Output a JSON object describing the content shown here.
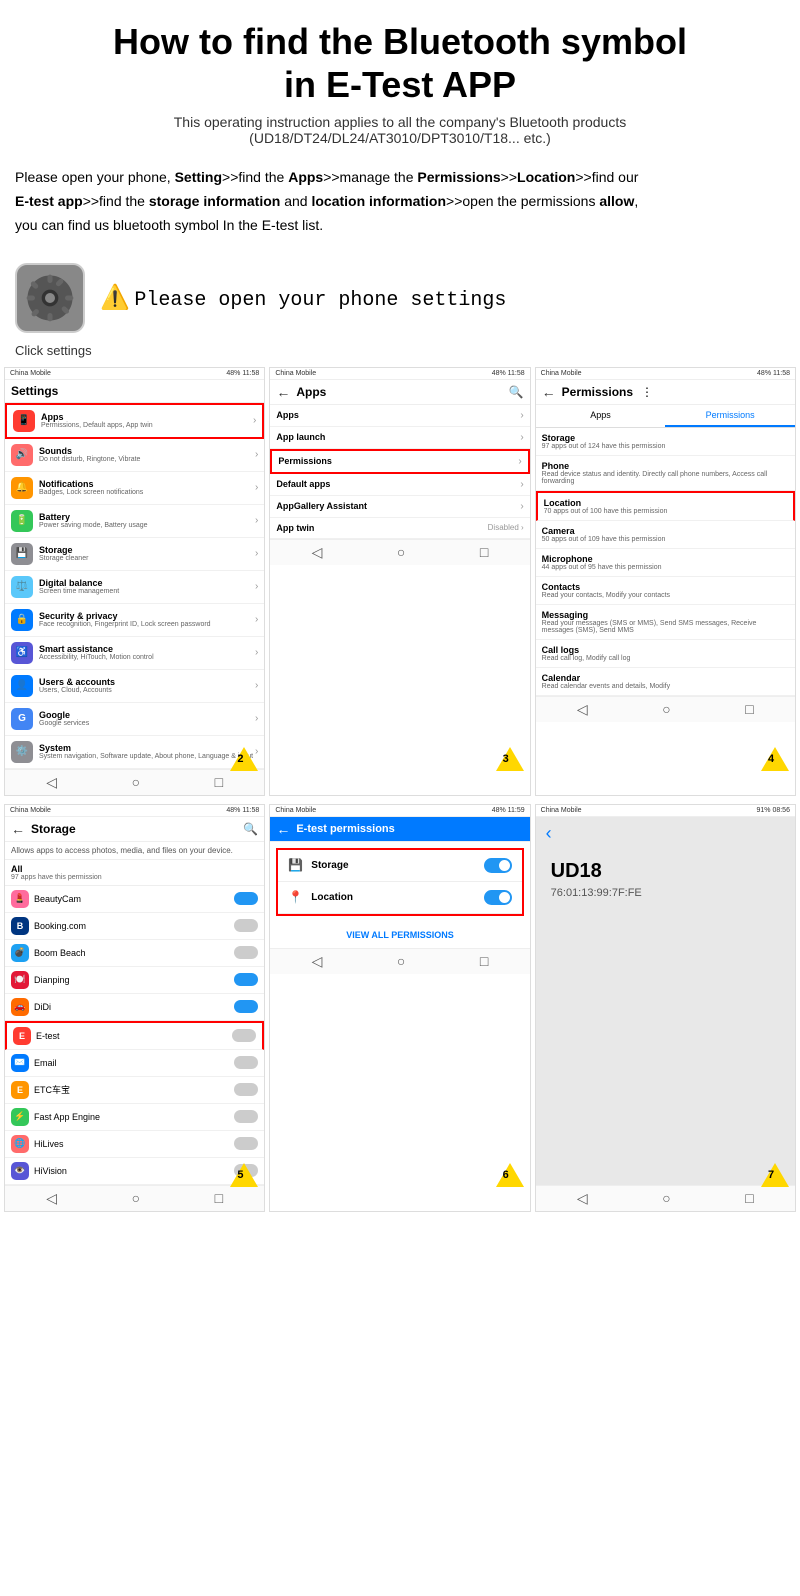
{
  "header": {
    "title": "How to find the Bluetooth symbol\nin E-Test APP",
    "subtitle": "This operating instruction applies to all the company's Bluetooth products\n(UD18/DT24/DL24/AT3010/DPT3010/T18... etc.)"
  },
  "instructions": {
    "line1": "Please open your phone, Setting>>find the Apps>>manage the Permissions>>Location>>find our",
    "line2": "E-test app>>find the storage information and location information>>open the permissions allow,",
    "line3": "you can find us bluetooth symbol In the E-test list."
  },
  "step0": {
    "label": "Please open your phone settings",
    "click": "Click settings"
  },
  "screen1": {
    "status": "China Mobile  48%  11:58",
    "title": "Settings",
    "items": [
      {
        "icon": "🔊",
        "color": "#FF6B6B",
        "title": "Sounds",
        "sub": "Do not disturb, Ringtone, Vibrate"
      },
      {
        "icon": "🔔",
        "color": "#FF9500",
        "title": "Notifications",
        "sub": "Badges, Lock screen notifications"
      },
      {
        "icon": "📱",
        "color": "#FF3B30",
        "title": "Apps",
        "sub": "Permissions, Default apps, App twin",
        "highlighted": true
      },
      {
        "icon": "🔋",
        "color": "#34C759",
        "title": "Battery",
        "sub": "Power saving mode, Battery usage"
      },
      {
        "icon": "💾",
        "color": "#8E8E93",
        "title": "Storage",
        "sub": "Storage cleaner"
      },
      {
        "icon": "⚖️",
        "color": "#5AC8FA",
        "title": "Digital balance",
        "sub": "Screen time management"
      },
      {
        "icon": "🔒",
        "color": "#007AFF",
        "title": "Security & privacy",
        "sub": "Face recognition, Fingerprint ID, Lock screen password"
      },
      {
        "icon": "♿",
        "color": "#5856D6",
        "title": "Smart assistance",
        "sub": "Accessibility, HiTouch, Motion control"
      },
      {
        "icon": "👤",
        "color": "#007AFF",
        "title": "Users & accounts",
        "sub": "Users, Cloud, Accounts"
      },
      {
        "icon": "G",
        "color": "#4285F4",
        "title": "Google",
        "sub": "Google services"
      },
      {
        "icon": "⚙️",
        "color": "#8E8E93",
        "title": "System",
        "sub": "System navigation, Software update, About phone, Language & input"
      }
    ],
    "stepNum": "2"
  },
  "screen2": {
    "status": "China Mobile  48%  11:58",
    "title": "Apps",
    "items": [
      {
        "label": "Apps"
      },
      {
        "label": "App launch"
      },
      {
        "label": "Permissions",
        "highlighted": true
      },
      {
        "label": "Default apps"
      },
      {
        "label": "AppGallery Assistant"
      },
      {
        "label": "App twin",
        "value": "Disabled"
      }
    ],
    "stepNum": "3"
  },
  "screen3": {
    "status": "China Mobile  48%  11:58",
    "title": "Permissions",
    "tabs": [
      "Apps",
      "Permissions"
    ],
    "activeTab": "Permissions",
    "items": [
      {
        "icon": "💾",
        "title": "Storage",
        "sub": "97 apps out of 124 have this permission"
      },
      {
        "icon": "📞",
        "title": "Phone",
        "sub": "Read device status and identity. Directly call phone numbers, Access call forwarding"
      },
      {
        "icon": "📍",
        "title": "Location",
        "sub": "70 apps out of 100 have this permission",
        "highlighted": true
      },
      {
        "icon": "📷",
        "title": "Camera",
        "sub": "50 apps out of 109 have this permission"
      },
      {
        "icon": "🎤",
        "title": "Microphone",
        "sub": "44 apps out of 95 have this permission"
      },
      {
        "icon": "👥",
        "title": "Contacts",
        "sub": "Read your contacts, Modify your contacts"
      },
      {
        "icon": "💬",
        "title": "Messaging",
        "sub": "Read your messages (SMS or MMS), Send SMS messages, Receive messages (SMS), Send MMS"
      },
      {
        "icon": "📋",
        "title": "Call logs",
        "sub": "Read call log, Modify call log"
      },
      {
        "icon": "📅",
        "title": "Calendar",
        "sub": "Read calendar events and details, Modify"
      }
    ],
    "stepNum": "4"
  },
  "screen4": {
    "status": "China Mobile  48%  11:58",
    "title": "Storage",
    "desc": "Allows apps to access photos, media, and files on your device.",
    "allLabel": "All",
    "allSub": "97 apps have this permission",
    "apps": [
      {
        "icon": "💄",
        "color": "#FF6B9D",
        "name": "BeautyCam",
        "on": true
      },
      {
        "icon": "B",
        "color": "#003580",
        "name": "Booking.com",
        "on": false
      },
      {
        "icon": "💣",
        "color": "#1DA1F2",
        "name": "Boom Beach",
        "on": false
      },
      {
        "icon": "🍽️",
        "color": "#E31837",
        "name": "Dianping",
        "on": true
      },
      {
        "icon": "🚗",
        "color": "#FF6B00",
        "name": "DiDi",
        "on": true
      },
      {
        "icon": "E",
        "color": "#FF3B30",
        "name": "E-test",
        "on": false,
        "highlighted": true
      },
      {
        "icon": "✉️",
        "color": "#007AFF",
        "name": "Email",
        "on": false
      },
      {
        "icon": "E",
        "color": "#FF9500",
        "name": "ETC车宝",
        "on": false
      },
      {
        "icon": "⚡",
        "color": "#34C759",
        "name": "Fast App Engine",
        "on": false
      },
      {
        "icon": "🌐",
        "color": "#FF6B6B",
        "name": "HiLives",
        "on": false
      },
      {
        "icon": "👁️",
        "color": "#5856D6",
        "name": "HiVision",
        "on": false
      }
    ],
    "stepNum": "5"
  },
  "screen5": {
    "status": "China Mobile  48%  11:59",
    "title": "E-test permissions",
    "perms": [
      {
        "icon": "💾",
        "label": "Storage",
        "on": true
      },
      {
        "icon": "📍",
        "label": "Location",
        "on": true
      }
    ],
    "viewAll": "VIEW ALL PERMISSIONS",
    "stepNum": "6"
  },
  "screen6": {
    "status": "91%  08:56",
    "title": "UD18",
    "address": "76:01:13:99:7F:FE",
    "stepNum": "7"
  }
}
